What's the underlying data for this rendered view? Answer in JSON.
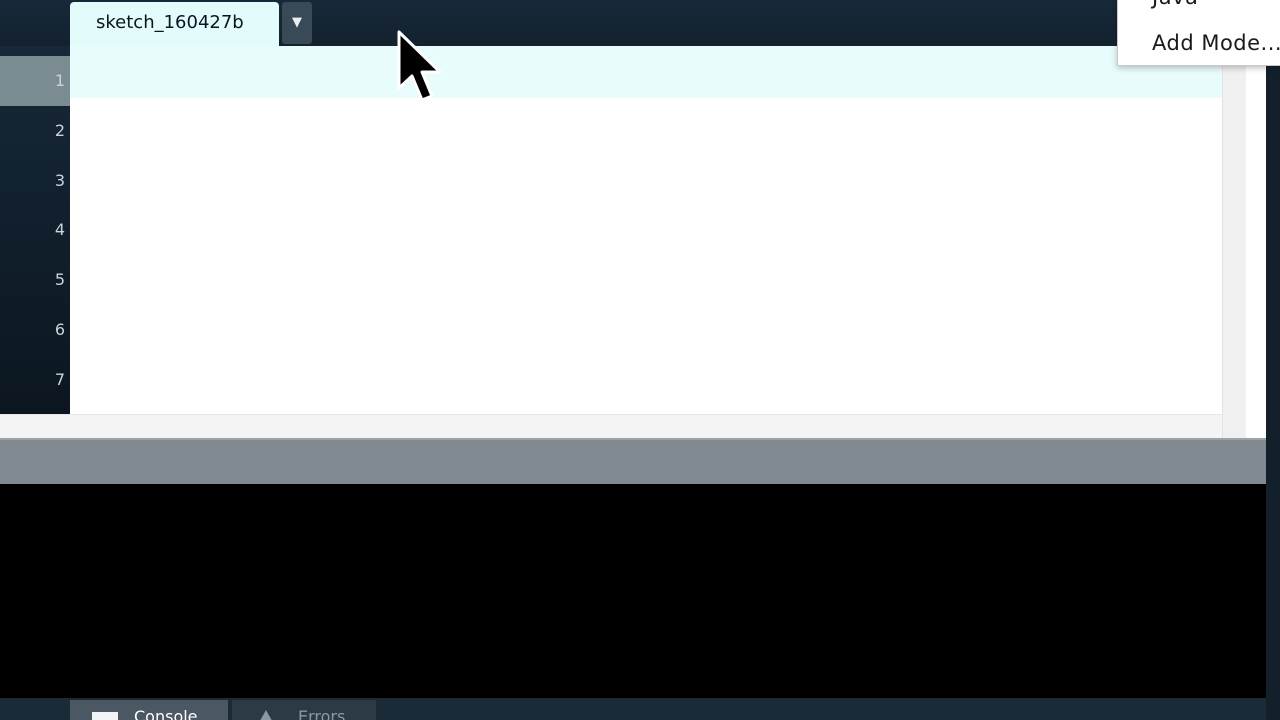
{
  "editor": {
    "tab_label": "sketch_160427b",
    "tab_menu_glyph": "▼",
    "line_numbers": [
      "1",
      "2",
      "3",
      "4",
      "5",
      "6",
      "7"
    ]
  },
  "mode_menu": {
    "checked_item": "Java",
    "check_glyph": "✓",
    "add_mode_label": "Add Mode..."
  },
  "footer": {
    "console_label": "Console",
    "errors_label": "Errors"
  },
  "icons": {
    "tab_menu": "chevron-down-icon",
    "console": "console-icon",
    "errors": "warning-icon",
    "cursor": "mouse-pointer-icon"
  },
  "colors": {
    "dark_bg": "#14222f",
    "tab_bg": "#e2fbfb",
    "current_line": "#e8fcfc",
    "console_bg": "#000000",
    "divider": "#80898f"
  }
}
